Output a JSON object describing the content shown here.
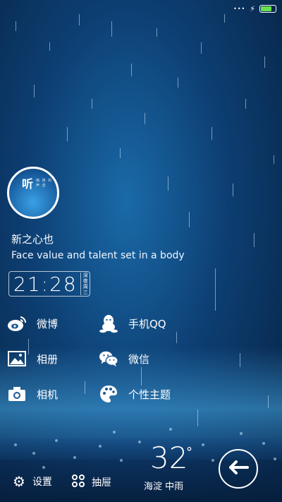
{
  "status": {
    "charging_symbol": "⚡",
    "battery_level": 0.85
  },
  "profile": {
    "avatar_char": "听",
    "avatar_sub": "雨 夜 的 声 音",
    "name": "新之心也",
    "motto": "Face value and talent set in a body"
  },
  "clock": {
    "time": "21:28",
    "period": "深夜",
    "weekday": "周三"
  },
  "apps": [
    {
      "label": "微博",
      "icon": "weibo-icon"
    },
    {
      "label": "手机QQ",
      "icon": "qq-icon"
    },
    {
      "label": "相册",
      "icon": "gallery-icon"
    },
    {
      "label": "微信",
      "icon": "wechat-icon"
    },
    {
      "label": "相机",
      "icon": "camera-icon"
    },
    {
      "label": "个性主题",
      "icon": "theme-palette-icon"
    }
  ],
  "bottom": {
    "settings_label": "设置",
    "drawer_label": "抽屉",
    "temperature": "32",
    "degree": "°",
    "location": "海淀 中雨"
  }
}
